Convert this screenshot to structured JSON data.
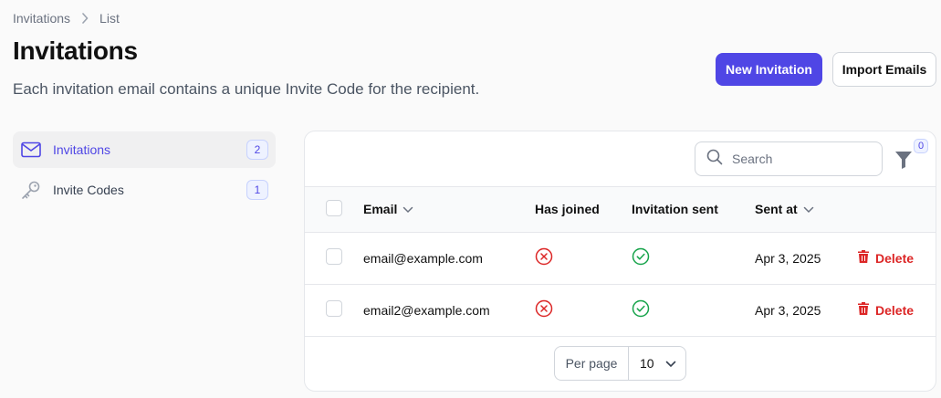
{
  "breadcrumb": {
    "items": [
      "Invitations",
      "List"
    ]
  },
  "page": {
    "title": "Invitations",
    "subtitle": "Each invitation email contains a unique Invite Code for the recipient."
  },
  "actions": {
    "new_invitation": "New Invitation",
    "import_emails": "Import Emails"
  },
  "colors": {
    "accent": "#4f46e5",
    "danger": "#dc2626",
    "success": "#16a34a"
  },
  "sidebar": {
    "items": [
      {
        "label": "Invitations",
        "badge": "2",
        "icon": "envelope-icon",
        "active": true
      },
      {
        "label": "Invite Codes",
        "badge": "1",
        "icon": "key-icon",
        "active": false
      }
    ]
  },
  "table": {
    "search_placeholder": "Search",
    "filter_count": "0",
    "columns": {
      "email": "Email",
      "has_joined": "Has joined",
      "invitation_sent": "Invitation sent",
      "sent_at": "Sent at"
    },
    "rows": [
      {
        "email": "email@example.com",
        "has_joined": false,
        "invitation_sent": true,
        "sent_at": "Apr 3, 2025",
        "delete": "Delete"
      },
      {
        "email": "email2@example.com",
        "has_joined": false,
        "invitation_sent": true,
        "sent_at": "Apr 3, 2025",
        "delete": "Delete"
      }
    ],
    "pagination": {
      "per_page_label": "Per page",
      "per_page_value": "10"
    }
  }
}
